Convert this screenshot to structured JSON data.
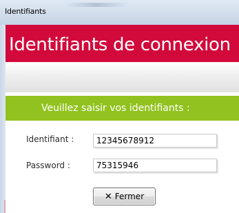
{
  "window": {
    "title": "Identifiants"
  },
  "header": {
    "title": "Identifiants de connexion"
  },
  "banner": {
    "text": "Veuillez saisir vos identifiants :"
  },
  "form": {
    "identifiant_label": "Identifiant :",
    "identifiant_value": "12345678912",
    "password_label": "Password :",
    "password_value": "75315946"
  },
  "buttons": {
    "close_icon": "✕",
    "close_label": "Fermer"
  },
  "colors": {
    "header": "#d20a3c",
    "banner": "#91c21f"
  }
}
